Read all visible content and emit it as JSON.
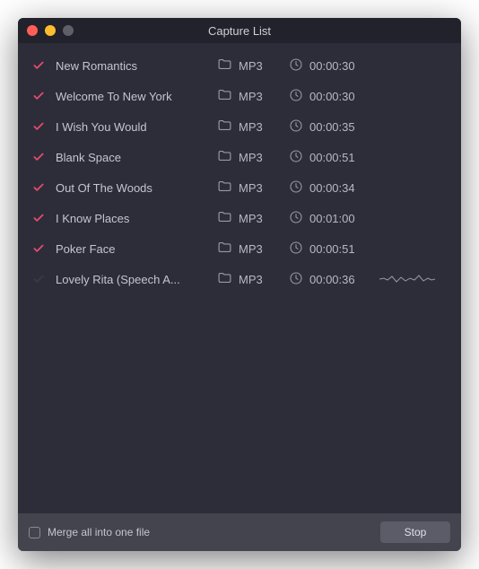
{
  "window": {
    "title": "Capture List"
  },
  "tracks": [
    {
      "name": "New Romantics",
      "format": "MP3",
      "duration": "00:00:30",
      "status": "done",
      "recording": false
    },
    {
      "name": "Welcome To New York",
      "format": "MP3",
      "duration": "00:00:30",
      "status": "done",
      "recording": false
    },
    {
      "name": "I Wish You Would",
      "format": "MP3",
      "duration": "00:00:35",
      "status": "done",
      "recording": false
    },
    {
      "name": "Blank Space",
      "format": "MP3",
      "duration": "00:00:51",
      "status": "done",
      "recording": false
    },
    {
      "name": "Out Of The Woods",
      "format": "MP3",
      "duration": "00:00:34",
      "status": "done",
      "recording": false
    },
    {
      "name": "I Know Places",
      "format": "MP3",
      "duration": "00:01:00",
      "status": "done",
      "recording": false
    },
    {
      "name": "Poker Face",
      "format": "MP3",
      "duration": "00:00:51",
      "status": "done",
      "recording": false
    },
    {
      "name": "Lovely Rita (Speech A...",
      "format": "MP3",
      "duration": "00:00:36",
      "status": "pending",
      "recording": true
    }
  ],
  "footer": {
    "merge_label": "Merge all into one file",
    "merge_checked": false,
    "stop_label": "Stop"
  },
  "colors": {
    "accent": "#e84a6f",
    "bg": "#2d2d3a",
    "footer_bg": "#44444f"
  }
}
